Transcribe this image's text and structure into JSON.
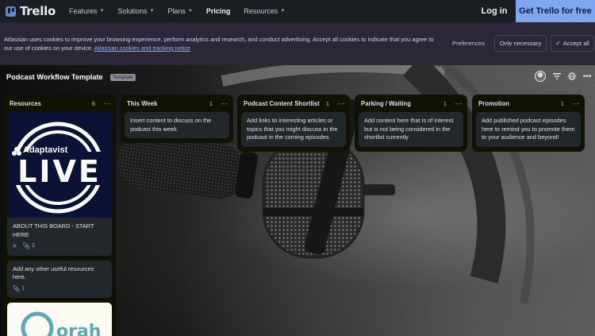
{
  "nav": {
    "logo": "Trello",
    "items": [
      {
        "label": "Features",
        "dropdown": true
      },
      {
        "label": "Solutions",
        "dropdown": true
      },
      {
        "label": "Plans",
        "dropdown": true
      },
      {
        "label": "Pricing",
        "dropdown": false
      },
      {
        "label": "Resources",
        "dropdown": true
      }
    ],
    "login": "Log in",
    "cta": "Get Trello for free"
  },
  "cookie": {
    "text": "Atlassian uses cookies to improve your browsing experience, perform analytics and research, and conduct advertising. Accept all cookies to indicate that you agree to our use of cookies on your device.",
    "link": "Atlassian cookies and tracking notice",
    "preferences": "Preferences",
    "only_necessary": "Only necessary",
    "accept_all": "Accept all"
  },
  "board": {
    "title": "Podcast Workflow Template",
    "badge": "Template",
    "lists": [
      {
        "title": "Resources",
        "count": "6",
        "cards": [
          {
            "cover": "Adaptavist LIVE",
            "cover_brand": "Adaptavist",
            "cover_word": "LIVE",
            "text": "ABOUT THIS BOARD - START HERE",
            "attachments": "3"
          },
          {
            "text": "Add any other useful resources here.",
            "attachments": "1"
          },
          {
            "cover_word": "orah"
          }
        ]
      },
      {
        "title": "This Week",
        "count": "1",
        "cards": [
          {
            "text": "Insert content to discuss on the podcast this week."
          }
        ]
      },
      {
        "title": "Podcast Content Shortlist",
        "count": "1",
        "cards": [
          {
            "text": "Add links to interesting articles or topics that you might discuss in the podcast in the coming episodes"
          }
        ]
      },
      {
        "title": "Parking / Waiting",
        "count": "1",
        "cards": [
          {
            "text": "Add content here that is of interest but is not being considered in the shortlist currently"
          }
        ]
      },
      {
        "title": "Promotion",
        "count": "1",
        "cards": [
          {
            "text": "Add published podcast episodes here to remind you to promote them to your audience and beyond!"
          }
        ]
      }
    ]
  },
  "icons": {
    "chevron": "chevron-down-icon",
    "collapse": "collapse-list-icon",
    "description": "description-icon",
    "attachment": "paperclip-icon",
    "filter": "filter-icon",
    "globe": "globe-icon",
    "more": "more-icon"
  }
}
